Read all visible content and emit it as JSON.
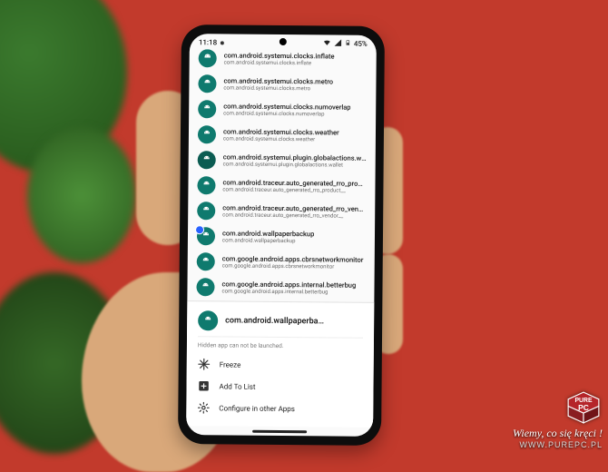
{
  "statusbar": {
    "time": "11:18",
    "battery_pct": "45%"
  },
  "apps": [
    {
      "title": "com.android.systemui.clocks.inflate",
      "sub": "com.android.systemui.clocks.inflate"
    },
    {
      "title": "com.android.systemui.clocks.metro",
      "sub": "com.android.systemui.clocks.metro"
    },
    {
      "title": "com.android.systemui.clocks.numoverlap",
      "sub": "com.android.systemui.clocks.numoverlap"
    },
    {
      "title": "com.android.systemui.clocks.weather",
      "sub": "com.android.systemui.clocks.weather"
    },
    {
      "title": "com.android.systemui.plugin.globalactions.wa…",
      "sub": "com.android.systemui.plugin.globalactions.wallet"
    },
    {
      "title": "com.android.traceur.auto_generated_rro_produ…",
      "sub": "com.android.traceur.auto_generated_rro_product__"
    },
    {
      "title": "com.android.traceur.auto_generated_rro_vendo…",
      "sub": "com.android.traceur.auto_generated_rro_vendor__"
    },
    {
      "title": "com.android.wallpaperbackup",
      "sub": "com.android.wallpaperbackup"
    },
    {
      "title": "com.google.android.apps.cbrsnetworkmonitor",
      "sub": "com.google.android.apps.cbrsnetworkmonitor"
    },
    {
      "title": "com.google.android.apps.internal.betterbug",
      "sub": "com.google.android.apps.internal.betterbug"
    }
  ],
  "selected": {
    "title": "com.android.wallpaperba…"
  },
  "hint": "Hidden app can not be launched.",
  "actions": {
    "freeze": "Freeze",
    "add": "Add To List",
    "configure": "Configure in other Apps"
  },
  "watermark": {
    "brand_top": "PURE",
    "brand_bottom": "PC",
    "slogan": "Wiemy, co się kręci !",
    "url": "WWW.PUREPC.PL"
  }
}
